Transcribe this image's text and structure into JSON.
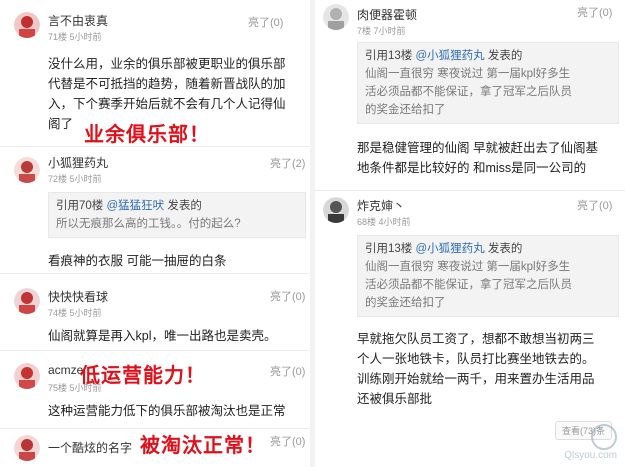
{
  "left": {
    "c1": {
      "name": "言不由衷真",
      "meta": "71楼 5小时前",
      "like": "亮了(0)",
      "lines": [
        "没什么用，业余的俱乐部被更职业的俱乐部",
        "代替是不可抵挡的趋势，随着新晋战队的加",
        "入，下个赛季开始后就不会有几个人记得仙",
        "阁了"
      ],
      "overlay": "业余俱乐部！"
    },
    "c2": {
      "name": "小狐狸药丸",
      "meta": "72楼 5小时前",
      "like": "亮了(2)",
      "quote_head_prefix": "引用70楼 ",
      "quote_head_at": "@猛猛狂吠",
      "quote_head_suffix": " 发表的",
      "quote_text": "所以无痕那么高的工钱。。付的起么?",
      "text": "看痕神的衣服 可能一抽屉的白条"
    },
    "c3": {
      "name": "快快快看球",
      "meta": "74楼 5小时前",
      "like": "亮了(0)",
      "text": "仙阁就算是再入kpl，唯一出路也是卖壳。"
    },
    "c4": {
      "name": "acmze",
      "meta": "75楼 5小时前",
      "like": "亮了(0)",
      "overlay": "低运营能力！",
      "text": "这种运营能力低下的俱乐部被淘汰也是正常"
    },
    "c5": {
      "name": "一个酷炫的名字",
      "like": "亮了(0)",
      "overlay": "被淘汰正常！"
    }
  },
  "right": {
    "c1": {
      "name": "肉便器霍顿",
      "meta": "7楼 7小时前",
      "like": "亮了(0)",
      "quote_head_prefix": "引用13楼 ",
      "quote_head_at": "@小狐狸药丸",
      "quote_head_suffix": " 发表的",
      "quote_text": "仙阁一直很穷 寒夜说过 第一届kpl好多生\n活必须品都不能保证，拿了冠军之后队员\n的奖金还给扣了",
      "text": "那是稳健管理的仙阁 早就被赶出去了仙阁基\n地条件都是比较好的 和miss是同一公司的"
    },
    "c2": {
      "name": "炸克婶丶",
      "meta": "68楼 4小时前",
      "like": "亮了(0)",
      "quote_head_prefix": "引用13楼 ",
      "quote_head_at": "@小狐狸药丸",
      "quote_head_suffix": " 发表的",
      "quote_text": "仙阁一直很穷 寒夜说过 第一届kpl好多生\n活必须品都不能保证，拿了冠军之后队员\n的奖金还给扣了",
      "text": "早就拖欠队员工资了，想都不敢想当初两三\n个人一张地铁卡，队员打比赛坐地铁去的。\n训练刚开始就给一两千，用来置办生活用品\n还被俱乐部批",
      "more": "查看(73)条"
    }
  },
  "watermark": {
    "domain": "Qlsyou.com"
  }
}
